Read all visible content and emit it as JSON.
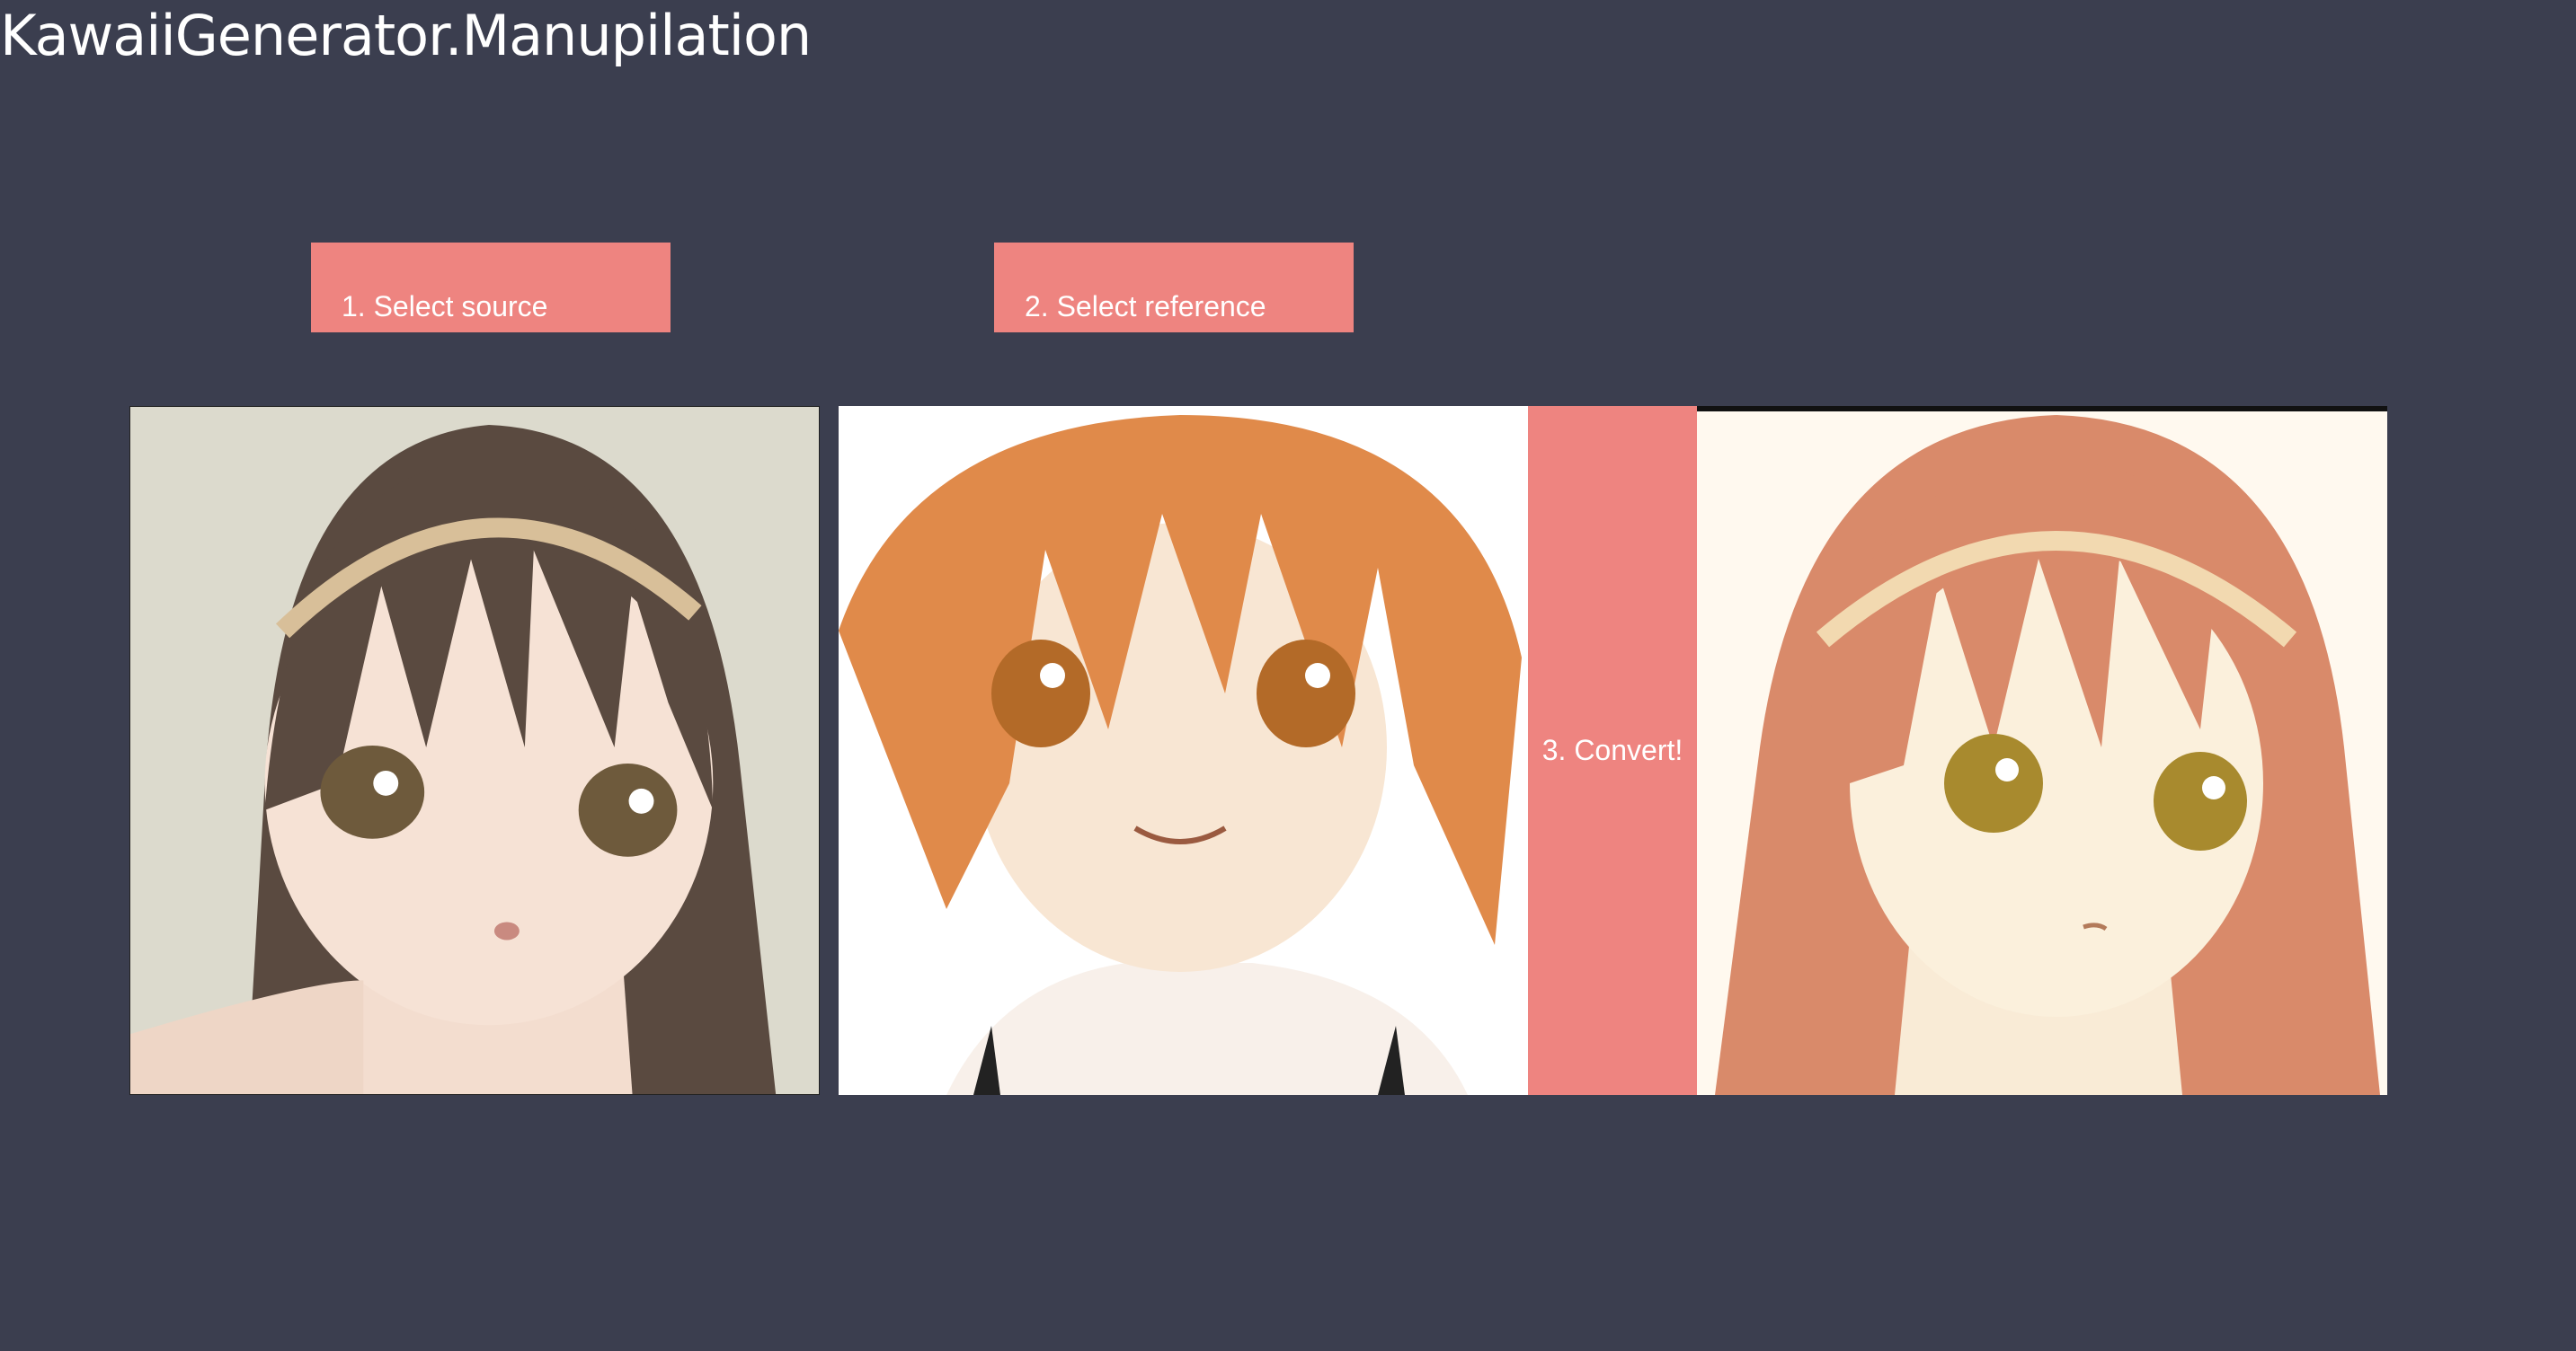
{
  "app": {
    "title": "KawaiiGenerator.Manupilation"
  },
  "controls": {
    "select_source_label": "1. Select source",
    "select_reference_label": "2. Select reference",
    "convert_label": "3. Convert!"
  },
  "images": {
    "source": {
      "description_icon": "anime-portrait-dark-hair"
    },
    "reference": {
      "description_icon": "anime-portrait-orange-short-hair"
    },
    "result": {
      "description_icon": "anime-portrait-auburn-long-hair"
    }
  },
  "colors": {
    "background": "#3b3e4f",
    "accent": "#ee8480",
    "text": "#ffffff"
  }
}
